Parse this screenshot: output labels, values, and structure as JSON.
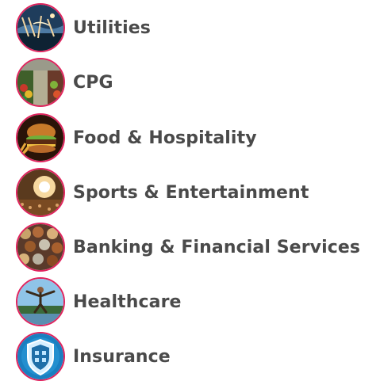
{
  "industries": [
    {
      "label": "Utilities",
      "icon": "utilities-photo-icon"
    },
    {
      "label": "CPG",
      "icon": "grocery-aisle-photo-icon"
    },
    {
      "label": "Food & Hospitality",
      "icon": "burger-photo-icon"
    },
    {
      "label": "Sports & Entertainment",
      "icon": "stadium-lights-photo-icon"
    },
    {
      "label": "Banking & Financial Services",
      "icon": "coins-photo-icon"
    },
    {
      "label": "Healthcare",
      "icon": "person-jumping-photo-icon"
    },
    {
      "label": "Insurance",
      "icon": "shield-photo-icon"
    }
  ],
  "colors": {
    "ring": "#e0245e",
    "text": "#4a4a4a"
  }
}
